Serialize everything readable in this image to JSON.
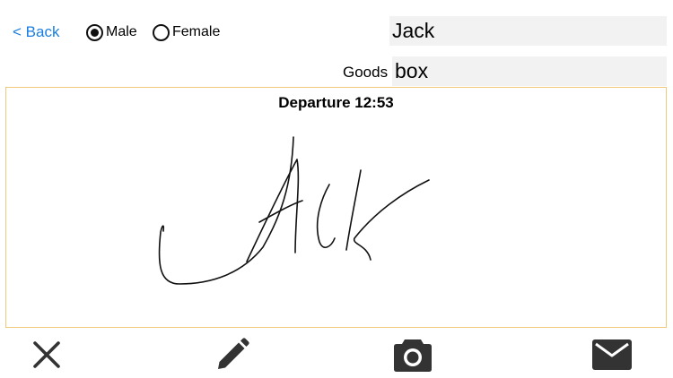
{
  "header": {
    "back_label": "< Back",
    "gender_options": [
      {
        "label": "Male",
        "selected": true
      },
      {
        "label": "Female",
        "selected": false
      }
    ],
    "name_value": "Jack"
  },
  "goods": {
    "label": "Goods",
    "value": "box"
  },
  "signature": {
    "departure_label": "Departure 12:53",
    "stroke_color": "#111111",
    "border_color": "#f0c97a"
  },
  "toolbar": {
    "buttons": [
      {
        "icon": "close-icon",
        "color": "#333333"
      },
      {
        "icon": "pencil-icon",
        "color": "#333333"
      },
      {
        "icon": "camera-icon",
        "color": "#333333"
      },
      {
        "icon": "mail-icon",
        "color": "#333333"
      }
    ]
  },
  "colors": {
    "link": "#1a7ee0",
    "field_background": "#f2f2f2"
  }
}
